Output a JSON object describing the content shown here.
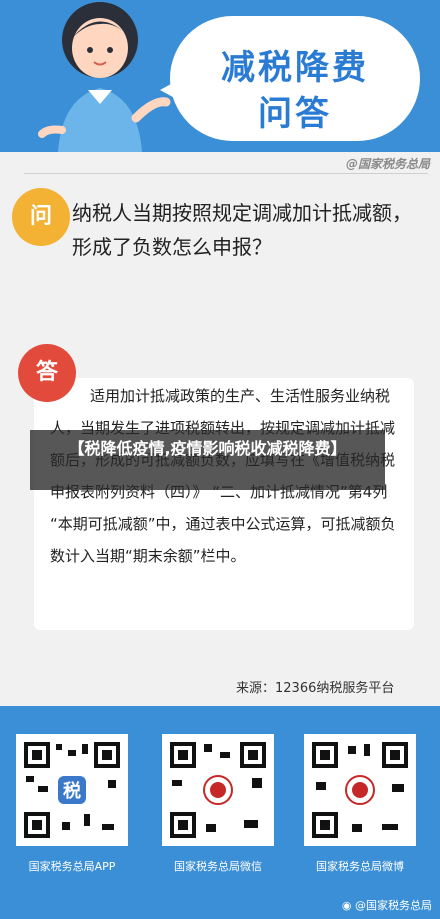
{
  "header": {
    "title_line1": "减税降费",
    "title_line2": "问答"
  },
  "brand": "@国家税务总局",
  "question": {
    "badge": "问",
    "text": "纳税人当期按照规定调减加计抵减额，形成了负数怎么申报？"
  },
  "answer": {
    "badge": "答",
    "text": "适用加计抵减政策的生产、生活性服务业纳税人，当期发生了进项税额转出，按规定调减加计抵减额后，形成的可抵减额负数，应填写在《增值税纳税申报表附列资料（四）》 “二、加计抵减情况”第4列 “本期可抵减额”中，通过表中公式运算，可抵减额负数计入当期“期末余额”栏中。"
  },
  "overlay": {
    "text": "【税降低疫情,疫情影响税收减税降费】"
  },
  "source": "来源：12366纳税服务平台",
  "qr": [
    {
      "label": "国家税务总局APP"
    },
    {
      "label": "国家税务总局微信"
    },
    {
      "label": "国家税务总局微博"
    }
  ],
  "footer": {
    "weibo": "@国家税务总局"
  },
  "colors": {
    "header_blue": "#3b8fd6",
    "question_badge": "#f3b233",
    "answer_badge": "#e24a3b"
  }
}
